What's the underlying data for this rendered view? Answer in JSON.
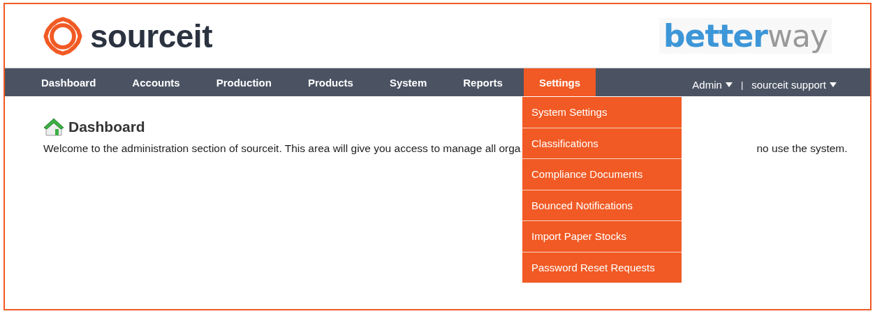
{
  "header": {
    "logo_text": "sourceit",
    "partner_logo": "**better**way"
  },
  "nav": {
    "items": [
      {
        "label": "Dashboard",
        "selected": false
      },
      {
        "label": "Accounts",
        "selected": false
      },
      {
        "label": "Production",
        "selected": false
      },
      {
        "label": "Products",
        "selected": false
      },
      {
        "label": "System",
        "selected": false
      },
      {
        "label": "Reports",
        "selected": false
      },
      {
        "label": "Settings",
        "selected": true
      }
    ],
    "user_menu": "Admin",
    "separator": "|",
    "support_menu": "sourceit support"
  },
  "dropdown": {
    "items": [
      "System Settings",
      "Classifications",
      "Compliance Documents",
      "Bounced Notifications",
      "Import Paper Stocks",
      "Password Reset Requests"
    ]
  },
  "content": {
    "title": "Dashboard",
    "welcome_visible_start": "Welcome to the administration section of sourceit. This area will give you access to manage all orga",
    "welcome_visible_end": "no use the system."
  }
}
